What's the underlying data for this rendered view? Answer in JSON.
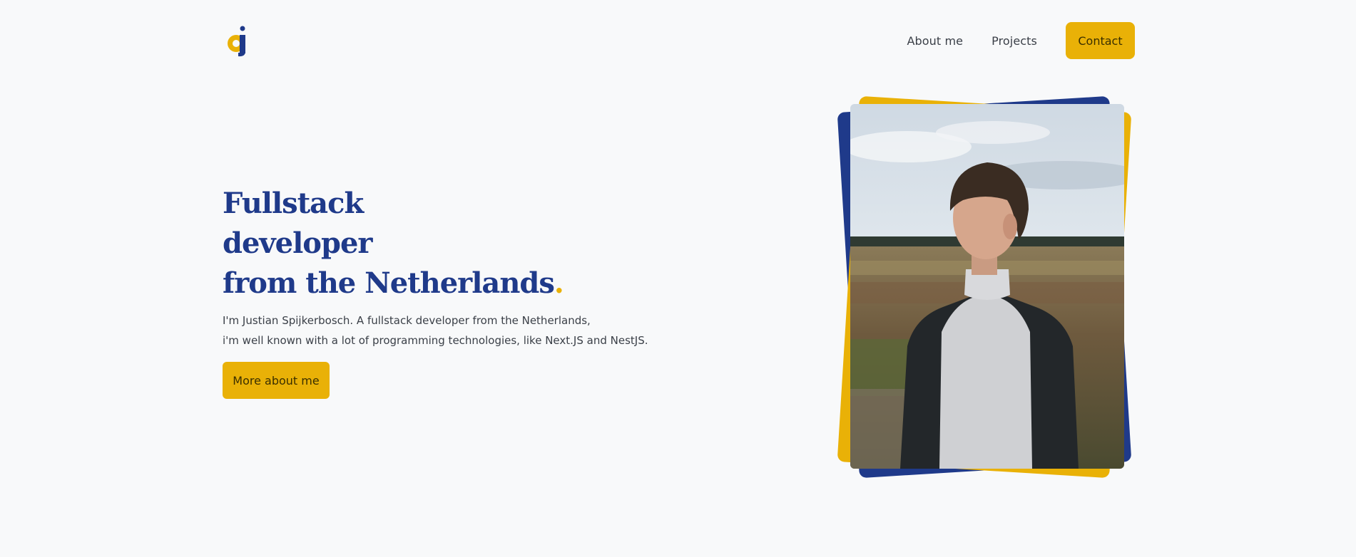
{
  "header": {
    "logo_icon": "dj-logo-icon",
    "nav": [
      {
        "label": "About me"
      },
      {
        "label": "Projects"
      }
    ],
    "contact_label": "Contact"
  },
  "hero": {
    "title_lines": [
      "Fullstack",
      "developer",
      "from the Netherlands"
    ],
    "title_dot": ".",
    "desc_lines": [
      "I'm Justian Spijkerbosch. A fullstack developer from the Netherlands,",
      "i'm well known with a lot of programming technologies, like Next.JS and NestJS."
    ],
    "button_label": "More about me"
  },
  "colors": {
    "background": "#f8f9fa",
    "primary_blue": "#1f3a8a",
    "accent_yellow": "#e9b107",
    "text": "#3a3f47"
  }
}
